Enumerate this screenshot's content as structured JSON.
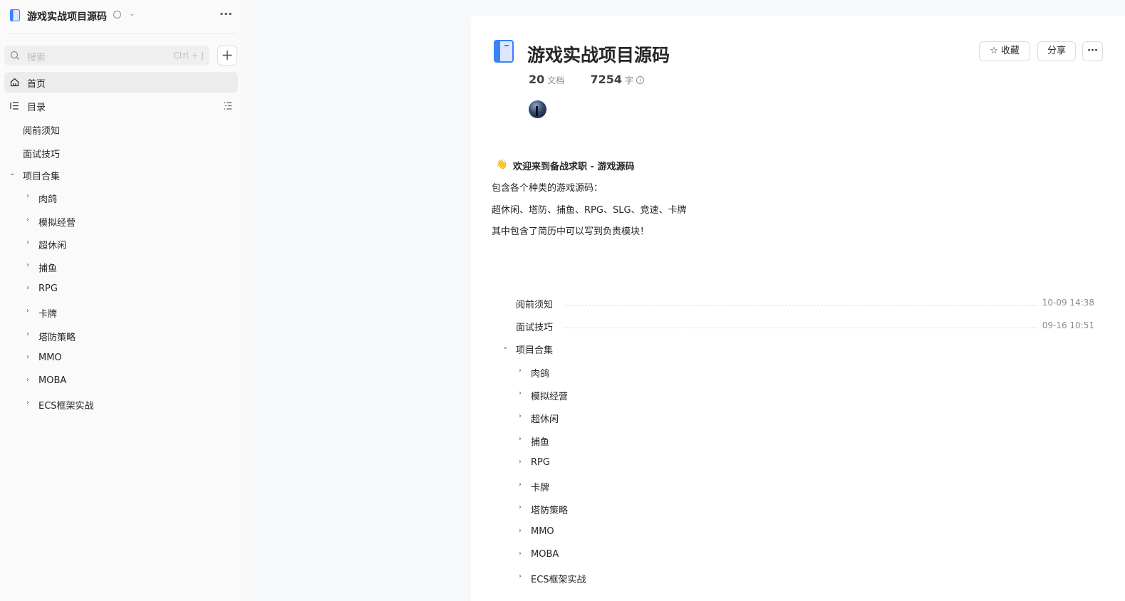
{
  "sidebar": {
    "title": "游戏实战项目源码",
    "search": {
      "placeholder": "搜索",
      "shortcut": "Ctrl + J"
    },
    "add_label": "+",
    "more_label": "···",
    "nav": {
      "home": "首页",
      "toc": "目录"
    },
    "items": [
      {
        "label": "阅前须知",
        "level": 1,
        "expandable": false
      },
      {
        "label": "面试技巧",
        "level": 1,
        "expandable": false
      },
      {
        "label": "项目合集",
        "level": 1,
        "expandable": true,
        "expanded": true
      },
      {
        "label": "肉鸽",
        "level": 2,
        "expandable": true
      },
      {
        "label": "模拟经营",
        "level": 2,
        "expandable": true
      },
      {
        "label": "超休闲",
        "level": 2,
        "expandable": true
      },
      {
        "label": "捕鱼",
        "level": 2,
        "expandable": true
      },
      {
        "label": "RPG",
        "level": 2,
        "expandable": true
      },
      {
        "label": "卡牌",
        "level": 2,
        "expandable": true
      },
      {
        "label": "塔防策略",
        "level": 2,
        "expandable": true
      },
      {
        "label": "MMO",
        "level": 2,
        "expandable": true
      },
      {
        "label": "MOBA",
        "level": 2,
        "expandable": true
      },
      {
        "label": "ECS框架实战",
        "level": 2,
        "expandable": true
      }
    ]
  },
  "main": {
    "title": "游戏实战项目源码",
    "actions": {
      "favorite": "收藏",
      "share": "分享",
      "more": "···"
    },
    "stats": {
      "docs_count": "20",
      "docs_unit": "文档",
      "words_count": "7254",
      "words_unit": "字"
    },
    "intro": {
      "heading": "欢迎来到备战求职 - 游戏源码",
      "lines": [
        "包含各个种类的游戏源码：",
        "超休闲、塔防、捕鱼、RPG、SLG、竞速、卡牌",
        "其中包含了简历中可以写到负责模块！"
      ]
    },
    "toc": [
      {
        "label": "阅前须知",
        "time": "10-09 14:38"
      },
      {
        "label": "面试技巧",
        "time": "09-16 10:51"
      },
      {
        "label": "项目合集",
        "expanded": true
      },
      {
        "label": "肉鸽"
      },
      {
        "label": "模拟经营"
      },
      {
        "label": "超休闲"
      },
      {
        "label": "捕鱼"
      },
      {
        "label": "RPG"
      },
      {
        "label": "卡牌"
      },
      {
        "label": "塔防策略"
      },
      {
        "label": "MMO"
      },
      {
        "label": "MOBA"
      },
      {
        "label": "ECS框架实战"
      }
    ]
  },
  "colors": {
    "accent": "#1f6feb",
    "book_blue": "#3b82f6"
  }
}
